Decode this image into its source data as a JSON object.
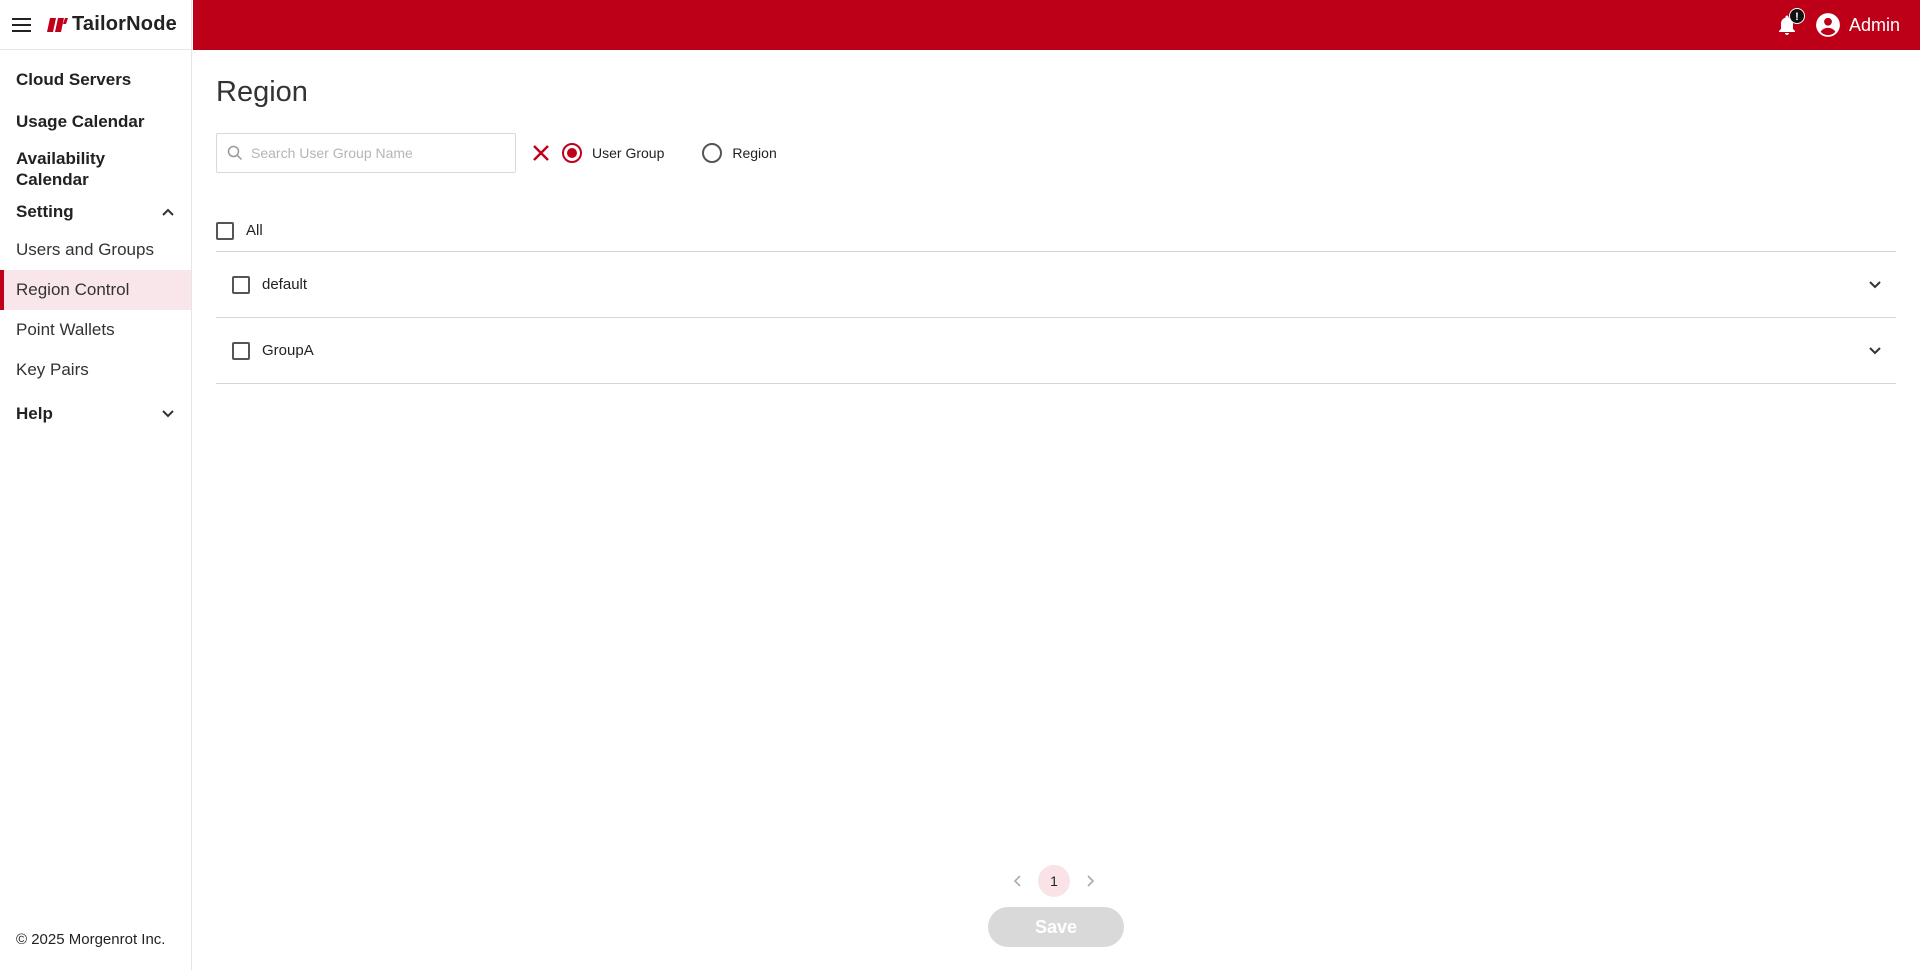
{
  "brand": {
    "name": "TailorNode"
  },
  "sidebar": {
    "items": [
      {
        "label": "Cloud Servers"
      },
      {
        "label": "Usage Calendar"
      },
      {
        "label": "Availability Calendar"
      }
    ],
    "setting": {
      "label": "Setting",
      "expanded": true,
      "subitems": [
        {
          "label": "Users and Groups"
        },
        {
          "label": "Region Control",
          "active": true
        },
        {
          "label": "Point Wallets"
        },
        {
          "label": "Key Pairs"
        }
      ]
    },
    "help": {
      "label": "Help",
      "expanded": false
    },
    "footer": "© 2025 Morgenrot Inc."
  },
  "header": {
    "notification_badge": "!",
    "user_name": "Admin",
    "bar_color": "#bd0017"
  },
  "main": {
    "title": "Region",
    "search": {
      "placeholder": "Search User Group Name",
      "value": ""
    },
    "view_options": [
      {
        "label": "User Group",
        "selected": true
      },
      {
        "label": "Region",
        "selected": false
      }
    ],
    "select_all_label": "All",
    "groups": [
      {
        "name": "default"
      },
      {
        "name": "GroupA"
      }
    ],
    "pagination": {
      "current_page": "1"
    },
    "save_label": "Save"
  },
  "colors": {
    "accent": "#c0001a",
    "active_bg": "#f9e6ea",
    "disabled_button": "#d9d9d9"
  }
}
